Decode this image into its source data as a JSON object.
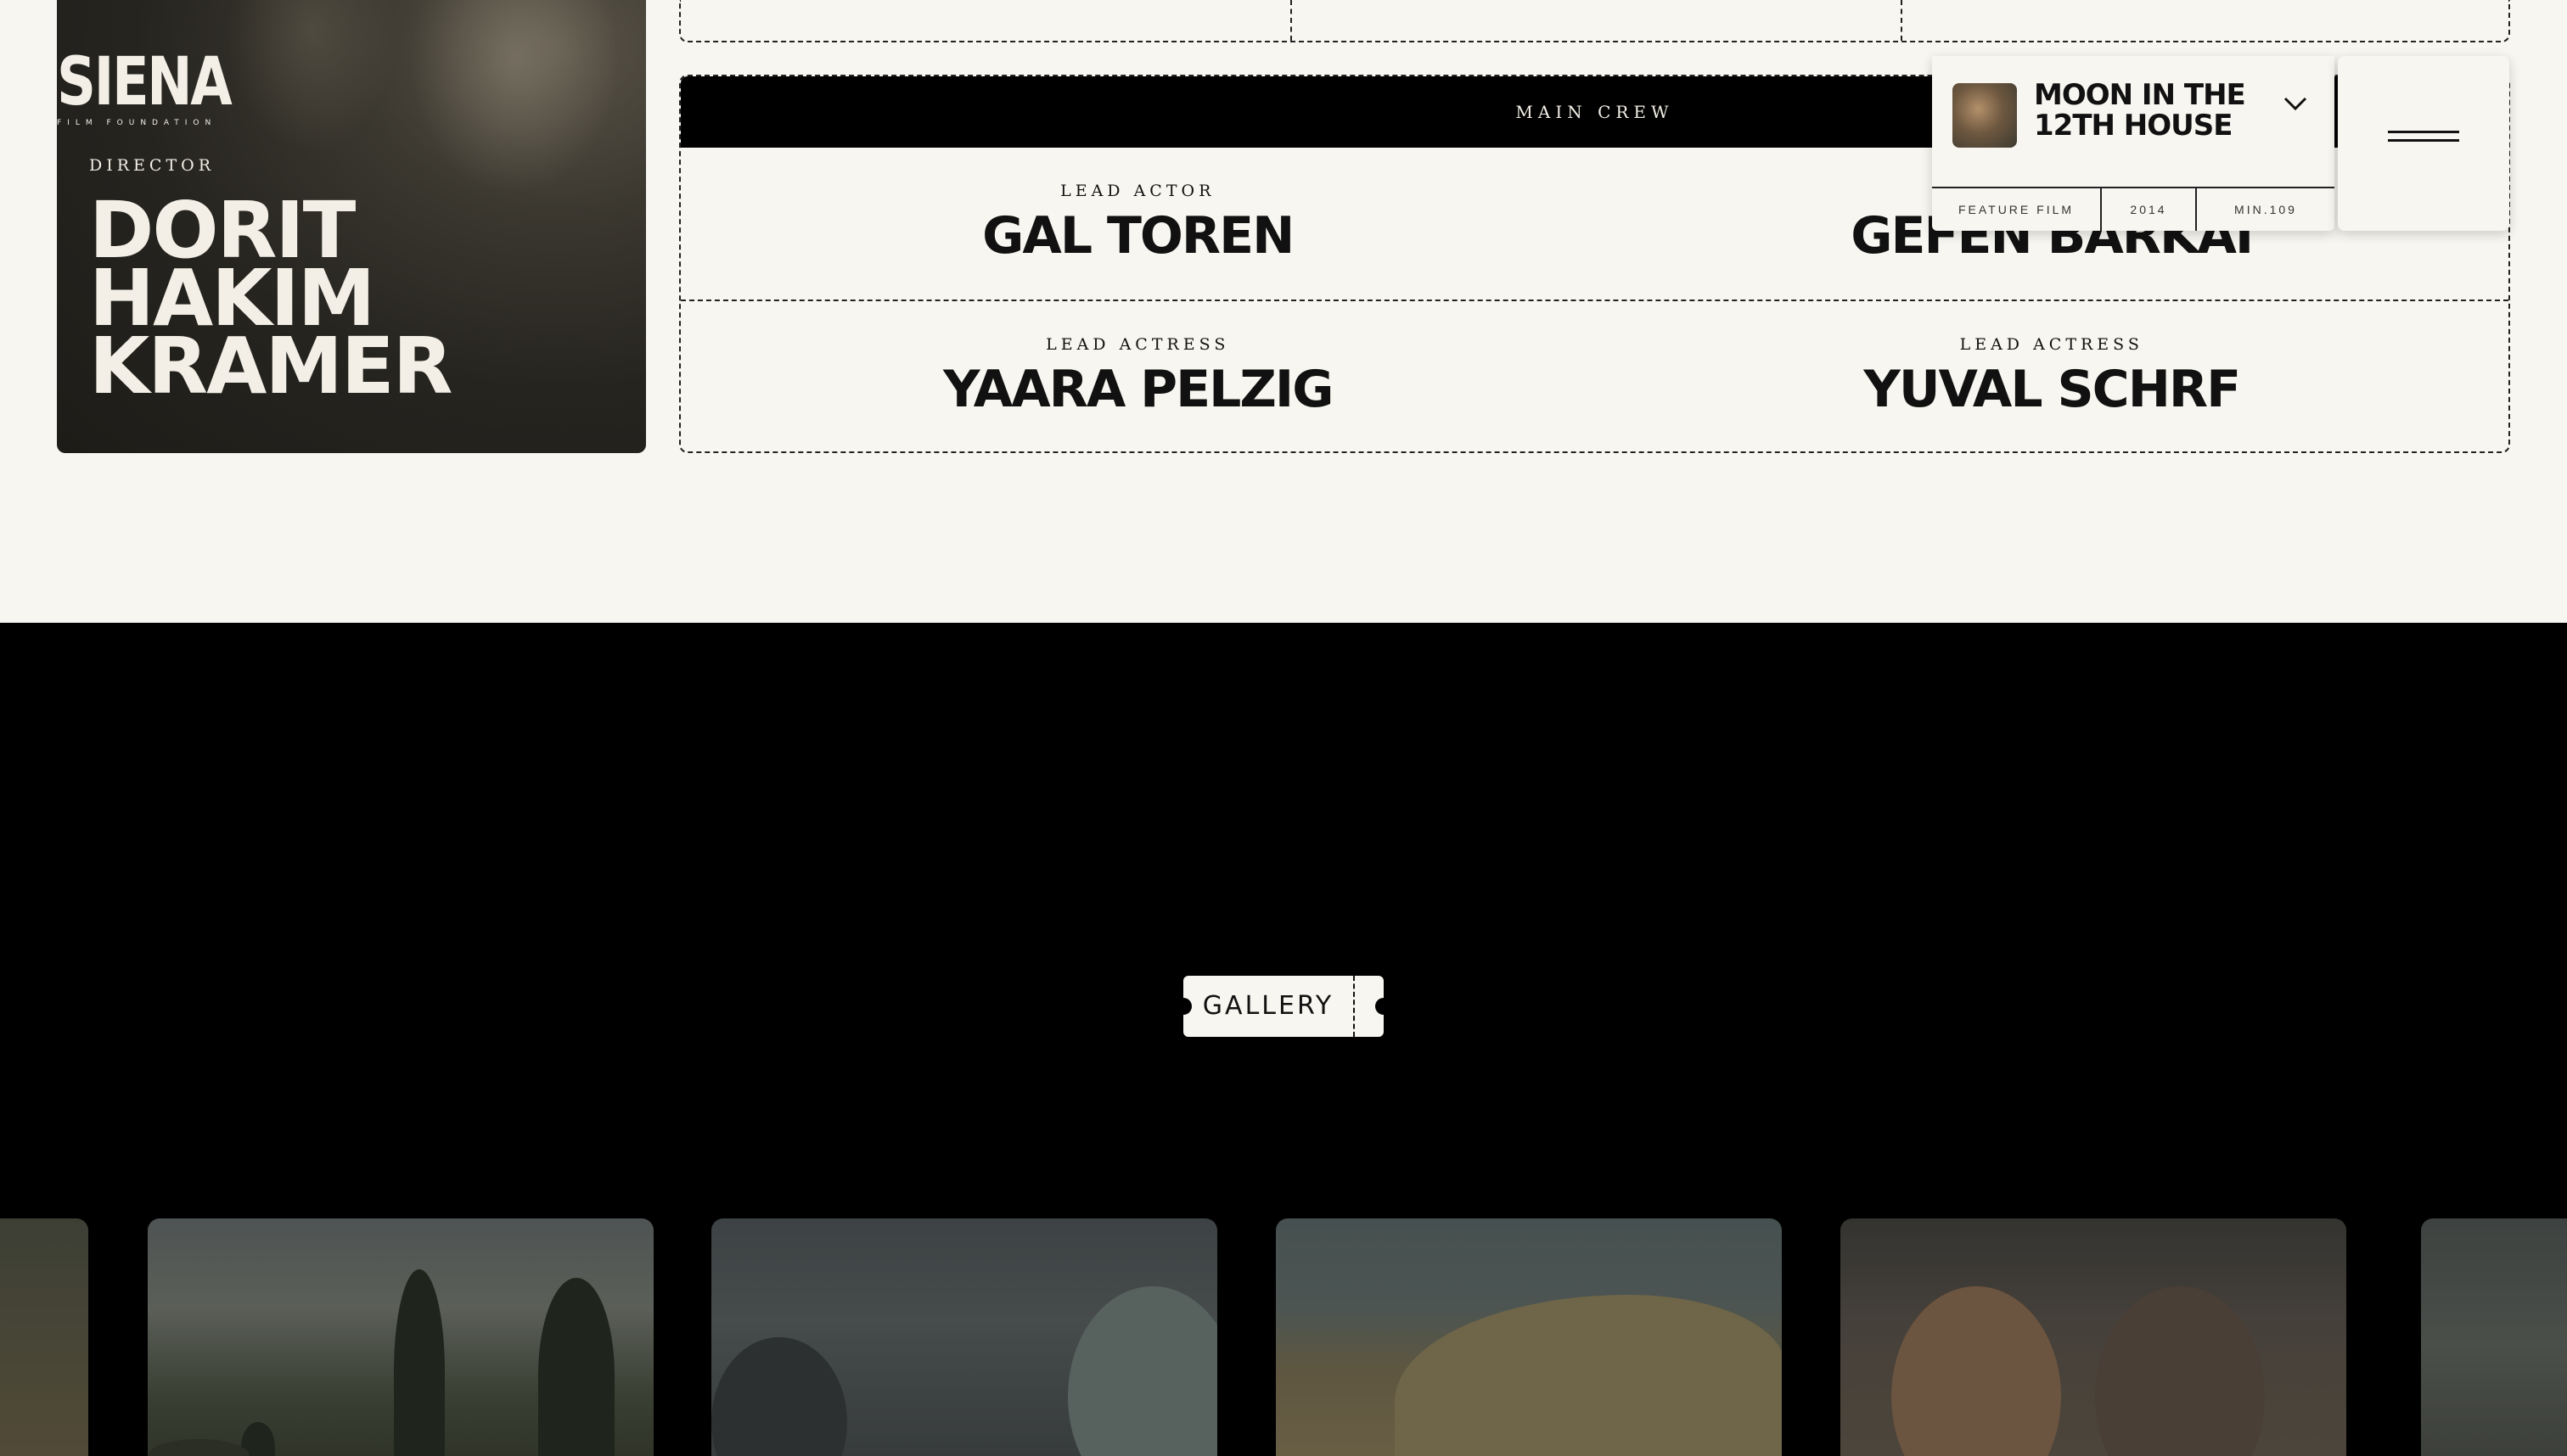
{
  "brand": {
    "name": "SIENA",
    "tagline": "FILM FOUNDATION"
  },
  "director": {
    "label": "DIRECTOR",
    "name_lines": [
      "DORIT",
      "HAKIM",
      "KRAMER"
    ]
  },
  "crew": {
    "header": "MAIN CREW",
    "members": [
      {
        "role": "LEAD ACTOR",
        "name": "GAL TOREN"
      },
      {
        "role": "",
        "name": "GEFEN BARKAI"
      },
      {
        "role": "LEAD ACTRESS",
        "name": "YAARA PELZIG"
      },
      {
        "role": "LEAD ACTRESS",
        "name": "YUVAL SCHRF"
      }
    ]
  },
  "film": {
    "title": "MOON IN THE 12TH HOUSE",
    "type": "FEATURE FILM",
    "year": "2014",
    "duration": "MIN.109",
    "icon": "chevron-down-icon"
  },
  "menu": {
    "icon": "hamburger-menu-icon"
  },
  "gallery": {
    "button_label": "GALLERY",
    "frames": [
      "still-1",
      "still-2",
      "still-3",
      "still-4",
      "still-5",
      "still-6"
    ]
  },
  "colors": {
    "background": "#f8f6f0",
    "ink": "#111111",
    "dark": "#000000"
  }
}
